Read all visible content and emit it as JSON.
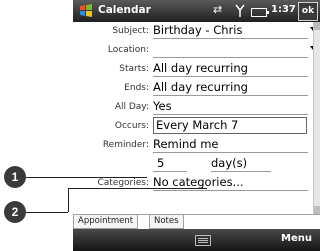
{
  "titlebar": {
    "app_title": "Calendar",
    "time": "1:37",
    "ok_label": "ok"
  },
  "fields": [
    {
      "label": "Subject:",
      "value": "Birthday - Chris",
      "dropdown": true
    },
    {
      "label": "Location:",
      "value": "",
      "dropdown": true
    },
    {
      "label": "Starts:",
      "value": "All day recurring"
    },
    {
      "label": "Ends:",
      "value": "All day recurring"
    },
    {
      "label": "All Day:",
      "value": "Yes"
    },
    {
      "label": "Occurs:",
      "value": "Every March 7",
      "selected": true
    },
    {
      "label": "Reminder:",
      "value": "Remind me"
    },
    {
      "label": "",
      "value": "5",
      "unit": "day(s)"
    },
    {
      "label": "Categories:",
      "value": "No categories..."
    }
  ],
  "tabs": [
    "Appointment",
    "Notes"
  ],
  "menubar": {
    "menu_label": "Menu"
  },
  "callouts": [
    "1",
    "2"
  ]
}
